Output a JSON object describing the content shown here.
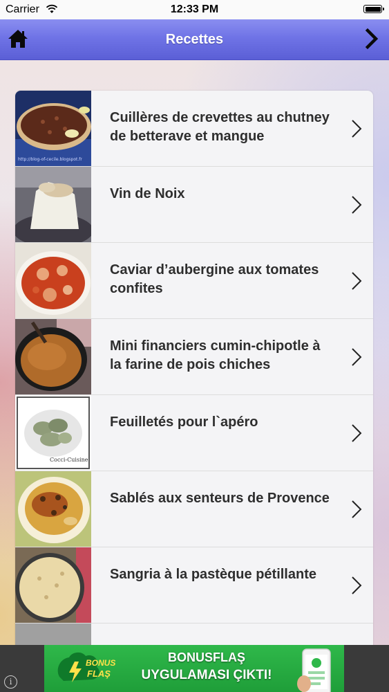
{
  "status_bar": {
    "carrier": "Carrier",
    "time": "12:33 PM",
    "wifi_icon": "wifi-icon",
    "battery_icon": "battery-icon"
  },
  "nav": {
    "title": "Recettes",
    "left_icon": "home-icon",
    "right_icon": "chevron-right-icon",
    "colors": {
      "top": "#8a8ef0",
      "bottom": "#5b5fd6",
      "title": "#ffffff"
    }
  },
  "recipes": [
    {
      "title": "Cuillères de crevettes au chutney de betterave et mangue",
      "thumb_caption": "http://blog-of-cecile.blogspot.fr"
    },
    {
      "title": "Vin de Noix"
    },
    {
      "title": "Caviar d’aubergine aux tomates confites"
    },
    {
      "title": "Mini financiers cumin-chipotle à la farine de pois chiches"
    },
    {
      "title": "Feuilletés pour l`apéro",
      "thumb_caption": "Cocci-Cuisine"
    },
    {
      "title": "Sablés aux senteurs de Provence"
    },
    {
      "title": "Sangria à la pastèque pétillante"
    }
  ],
  "ad": {
    "logo_line1": "BONUS",
    "logo_line2": "FLAŞ",
    "line1": "BONUSFLAŞ",
    "line2": "UYGULAMASI ÇIKTI!",
    "info_icon": "info-icon",
    "colors": {
      "banner": "#2fb84a",
      "frame": "#3a3a3a"
    }
  }
}
